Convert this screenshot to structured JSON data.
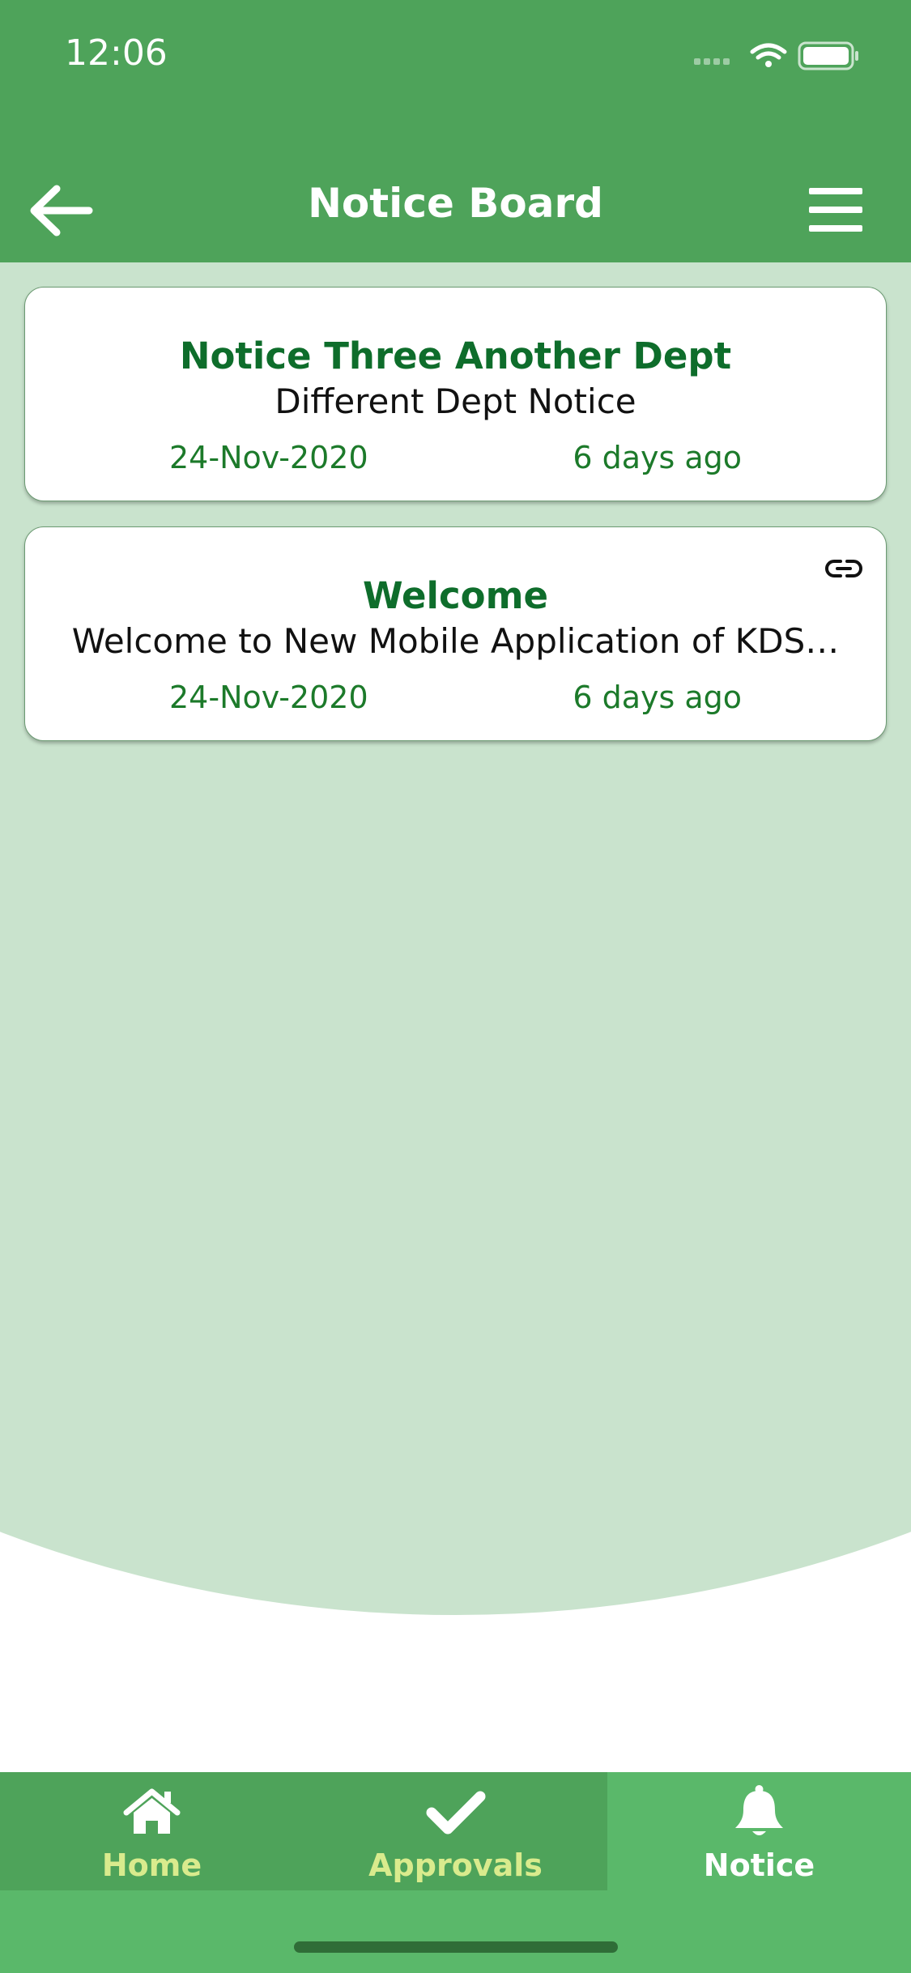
{
  "status_bar": {
    "time": "12:06",
    "icons": [
      "signal-icon",
      "wifi-icon",
      "battery-icon"
    ]
  },
  "header": {
    "title": "Notice Board",
    "back_icon": "arrow-left-icon",
    "menu_icon": "hamburger-menu-icon"
  },
  "notices": [
    {
      "title": "Notice Three Another Dept",
      "description": "Different Dept Notice",
      "date": "24-Nov-2020",
      "relative_time": "6 days ago",
      "has_link": false
    },
    {
      "title": "Welcome",
      "description": "Welcome to New Mobile Application of KDS…",
      "date": "24-Nov-2020",
      "relative_time": "6 days ago",
      "has_link": true,
      "link_icon": "link-icon"
    }
  ],
  "tabbar": {
    "tabs": [
      {
        "label": "Home",
        "icon": "home-icon",
        "active": false
      },
      {
        "label": "Approvals",
        "icon": "checkmark-icon",
        "active": false
      },
      {
        "label": "Notice",
        "icon": "bell-icon",
        "active": true
      }
    ]
  },
  "colors": {
    "primary_green": "#4ea35a",
    "active_tab_green": "#5ab86a",
    "light_green_bg": "#c9e3cd",
    "title_green": "#0e6d2b",
    "inactive_tab_label": "#d9eb8d"
  }
}
